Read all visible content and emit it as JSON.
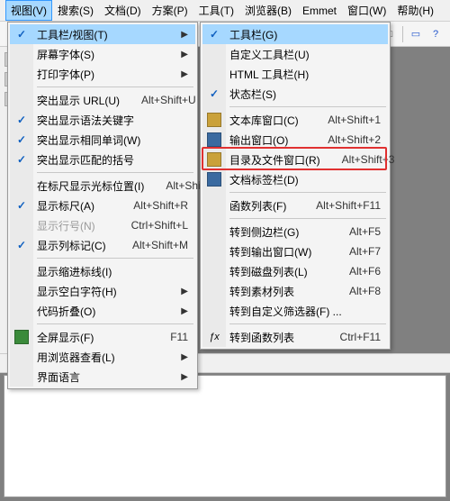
{
  "menubar": {
    "items": [
      "视图(V)",
      "搜索(S)",
      "文档(D)",
      "方案(P)",
      "工具(T)",
      "浏览器(B)",
      "Emmet",
      "窗口(W)",
      "帮助(H)"
    ],
    "active_index": 0
  },
  "menu1": {
    "items": [
      {
        "type": "item",
        "label": "工具栏/视图(T)",
        "checked": true,
        "submenu": true,
        "highlight": true
      },
      {
        "type": "item",
        "label": "屏幕字体(S)",
        "submenu": true
      },
      {
        "type": "item",
        "label": "打印字体(P)",
        "submenu": true
      },
      {
        "type": "sep"
      },
      {
        "type": "item",
        "label": "突出显示 URL(U)",
        "shortcut": "Alt+Shift+U"
      },
      {
        "type": "item",
        "label": "突出显示语法关键字",
        "checked": true
      },
      {
        "type": "item",
        "label": "突出显示相同单词(W)",
        "checked": true
      },
      {
        "type": "item",
        "label": "突出显示匹配的括号",
        "checked": true
      },
      {
        "type": "sep"
      },
      {
        "type": "item",
        "label": "在标尺显示光标位置(I)",
        "shortcut": "Alt+Shift+C"
      },
      {
        "type": "item",
        "label": "显示标尺(A)",
        "checked": true,
        "shortcut": "Alt+Shift+R"
      },
      {
        "type": "item",
        "label": "显示行号(N)",
        "disabled": true,
        "shortcut": "Ctrl+Shift+L"
      },
      {
        "type": "item",
        "label": "显示列标记(C)",
        "checked": true,
        "shortcut": "Alt+Shift+M"
      },
      {
        "type": "sep"
      },
      {
        "type": "item",
        "label": "显示缩进标线(I)"
      },
      {
        "type": "item",
        "label": "显示空白字符(H)",
        "submenu": true
      },
      {
        "type": "item",
        "label": "代码折叠(O)",
        "submenu": true
      },
      {
        "type": "sep"
      },
      {
        "type": "item",
        "label": "全屏显示(F)",
        "icon": "fullscreen-icon",
        "icon_color": "#3a8a3a",
        "shortcut": "F11"
      },
      {
        "type": "item",
        "label": "用浏览器查看(L)",
        "submenu": true
      },
      {
        "type": "item",
        "label": "界面语言",
        "submenu": true
      }
    ]
  },
  "menu2": {
    "items": [
      {
        "type": "item",
        "label": "工具栏(G)",
        "checked": true,
        "highlight": true
      },
      {
        "type": "item",
        "label": "自定义工具栏(U)"
      },
      {
        "type": "item",
        "label": "HTML 工具栏(H)"
      },
      {
        "type": "item",
        "label": "状态栏(S)",
        "checked": true
      },
      {
        "type": "sep"
      },
      {
        "type": "item",
        "label": "文本库窗口(C)",
        "icon": "textlib-icon",
        "icon_color": "#caa13a",
        "shortcut": "Alt+Shift+1"
      },
      {
        "type": "item",
        "label": "输出窗口(O)",
        "icon": "output-icon",
        "icon_color": "#3a6aa0",
        "shortcut": "Alt+Shift+2"
      },
      {
        "type": "item",
        "label": "目录及文件窗口(R)",
        "icon": "folders-icon",
        "icon_color": "#caa13a",
        "shortcut": "Alt+Shift+3",
        "red_outline": true
      },
      {
        "type": "item",
        "label": "文档标签栏(D)",
        "icon": "tabs-icon",
        "icon_color": "#3a6aa0"
      },
      {
        "type": "sep"
      },
      {
        "type": "item",
        "label": "函数列表(F)",
        "shortcut": "Alt+Shift+F11"
      },
      {
        "type": "sep"
      },
      {
        "type": "item",
        "label": "转到侧边栏(G)",
        "shortcut": "Alt+F5"
      },
      {
        "type": "item",
        "label": "转到输出窗口(W)",
        "shortcut": "Alt+F7"
      },
      {
        "type": "item",
        "label": "转到磁盘列表(L)",
        "shortcut": "Alt+F6"
      },
      {
        "type": "item",
        "label": "转到素材列表",
        "shortcut": "Alt+F8"
      },
      {
        "type": "item",
        "label": "转到自定义筛选器(F) ..."
      },
      {
        "type": "sep"
      },
      {
        "type": "item",
        "label": "转到函数列表",
        "icon": "func-icon",
        "icon_color": "#555",
        "shortcut": "Ctrl+F11"
      }
    ]
  }
}
